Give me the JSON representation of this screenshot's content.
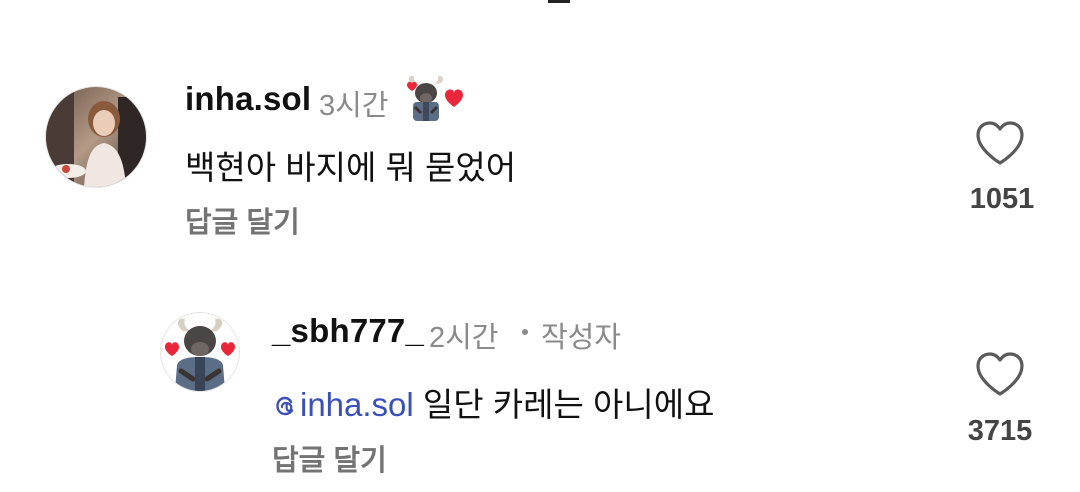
{
  "comments": [
    {
      "username": "inha.sol",
      "time": "3시간",
      "text": "백현아 바지에 뭐 묻었어",
      "reply_label": "답글 달기",
      "like_count": "1051",
      "sticker_icon": "bull-with-heart-sticker"
    }
  ],
  "replies": [
    {
      "username": "_sbh777_",
      "time": "2시간",
      "author_tag": "작성자",
      "mention": "inha.sol",
      "text": " 일단 카레는 아니에요",
      "reply_label": "답글 달기",
      "like_count": "3715"
    }
  ],
  "colors": {
    "mention": "#3b4fb8",
    "muted": "#8a8a8a",
    "heart": "#e8273a"
  }
}
